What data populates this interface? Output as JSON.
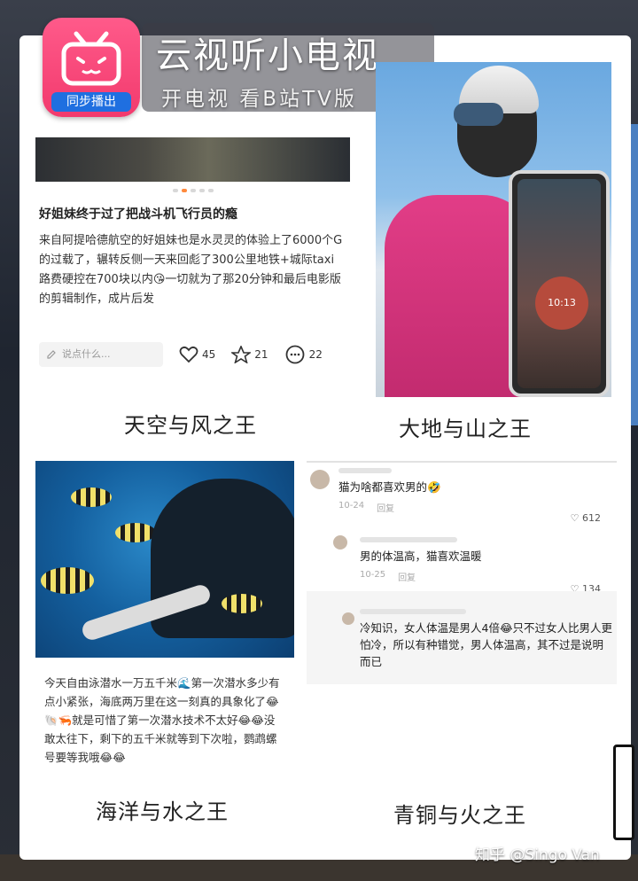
{
  "app": {
    "title": "云视听小电视",
    "subtitle": "开电视 看B站TV版",
    "badge_label": "同步播出"
  },
  "panel_sky": {
    "post_title": "好姐妹终于过了把战斗机飞行员的瘾",
    "post_body": "来自阿提哈德航空的好姐妹也是水灵灵的体验上了6000个G的过载了，辗转反侧一天来回彪了300公里地铁+城际taxi路费硬控在700块以内😘一切就为了那20分钟和最后电影版的剪辑制作，成片后发",
    "comment_placeholder": "说点什么...",
    "likes": "45",
    "stars": "21",
    "comments": "22",
    "caption": "天空与风之王"
  },
  "panel_earth": {
    "phone_timer": "10:13",
    "caption": "大地与山之王"
  },
  "panel_ocean": {
    "post_text": "今天自由泳潜水一万五千米🌊第一次潜水多少有点小紧张，海底两万里在这一刻真的具象化了😂🐚🦐就是可惜了第一次潜水技术不太好😂😂没敢太往下，剩下的五千米就等到下次啦，鹦鹉螺号要等我哦😂😂",
    "caption": "海洋与水之王"
  },
  "panel_fire": {
    "comments": [
      {
        "text": "猫为啥都喜欢男的🤣",
        "date": "10-24",
        "reply": "回复",
        "likes": "612"
      },
      {
        "text": "男的体温高，猫喜欢温暖",
        "date": "10-25",
        "reply": "回复",
        "likes": "134"
      },
      {
        "text": "冷知识，女人体温是男人4倍😂只不过女人比男人更怕冷，所以有种错觉，男人体温高，其不过是说明而已"
      }
    ],
    "caption": "青铜与火之王"
  },
  "watermark": "知乎 @Singo Van",
  "colors": {
    "badge_pink": "#f23a6d",
    "badge_blue": "#1f6fe0",
    "accent_orange": "#ff8a3d"
  }
}
